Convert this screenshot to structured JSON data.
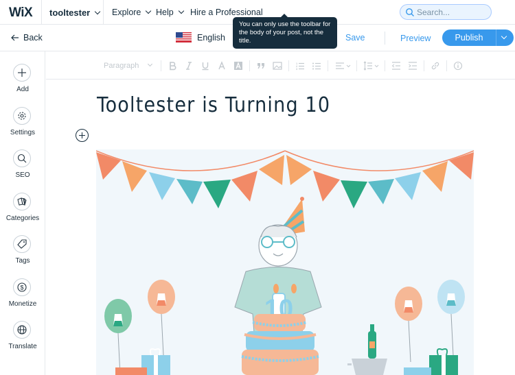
{
  "topnav": {
    "logo": "WiX",
    "site_name": "tooltester",
    "items": [
      "Explore",
      "Help",
      "Hire a Professional"
    ],
    "search_placeholder": "Search..."
  },
  "editor_header": {
    "back_label": "Back",
    "language": "English",
    "save_label": "Save",
    "preview_label": "Preview",
    "publish_label": "Publish"
  },
  "tooltip": {
    "text": "You can only use the toolbar for the body of your post, not the title."
  },
  "sidebar": {
    "items": [
      {
        "label": "Add",
        "icon": "plus-icon"
      },
      {
        "label": "Settings",
        "icon": "gear-icon"
      },
      {
        "label": "SEO",
        "icon": "search-icon"
      },
      {
        "label": "Categories",
        "icon": "categories-icon"
      },
      {
        "label": "Tags",
        "icon": "tag-icon"
      },
      {
        "label": "Monetize",
        "icon": "dollar-icon"
      },
      {
        "label": "Translate",
        "icon": "globe-icon"
      }
    ]
  },
  "toolbar": {
    "paragraph_label": "Paragraph",
    "buttons": [
      "bold",
      "italic",
      "underline",
      "text-color",
      "highlight",
      "quote",
      "code-block",
      "numbered-list",
      "bulleted-list",
      "alignment",
      "line-spacing",
      "decrease-indent",
      "increase-indent",
      "link",
      "more-info"
    ]
  },
  "post": {
    "title": "Tooltester is Turning 10",
    "cake_number": "10"
  },
  "colors": {
    "accent": "#3899ec",
    "dark_text": "#162d3d",
    "tooltip_bg": "#162d3d",
    "bunting_orange": "#f28a67",
    "bunting_blue": "#8dd0ea",
    "bunting_green": "#2aa882"
  }
}
